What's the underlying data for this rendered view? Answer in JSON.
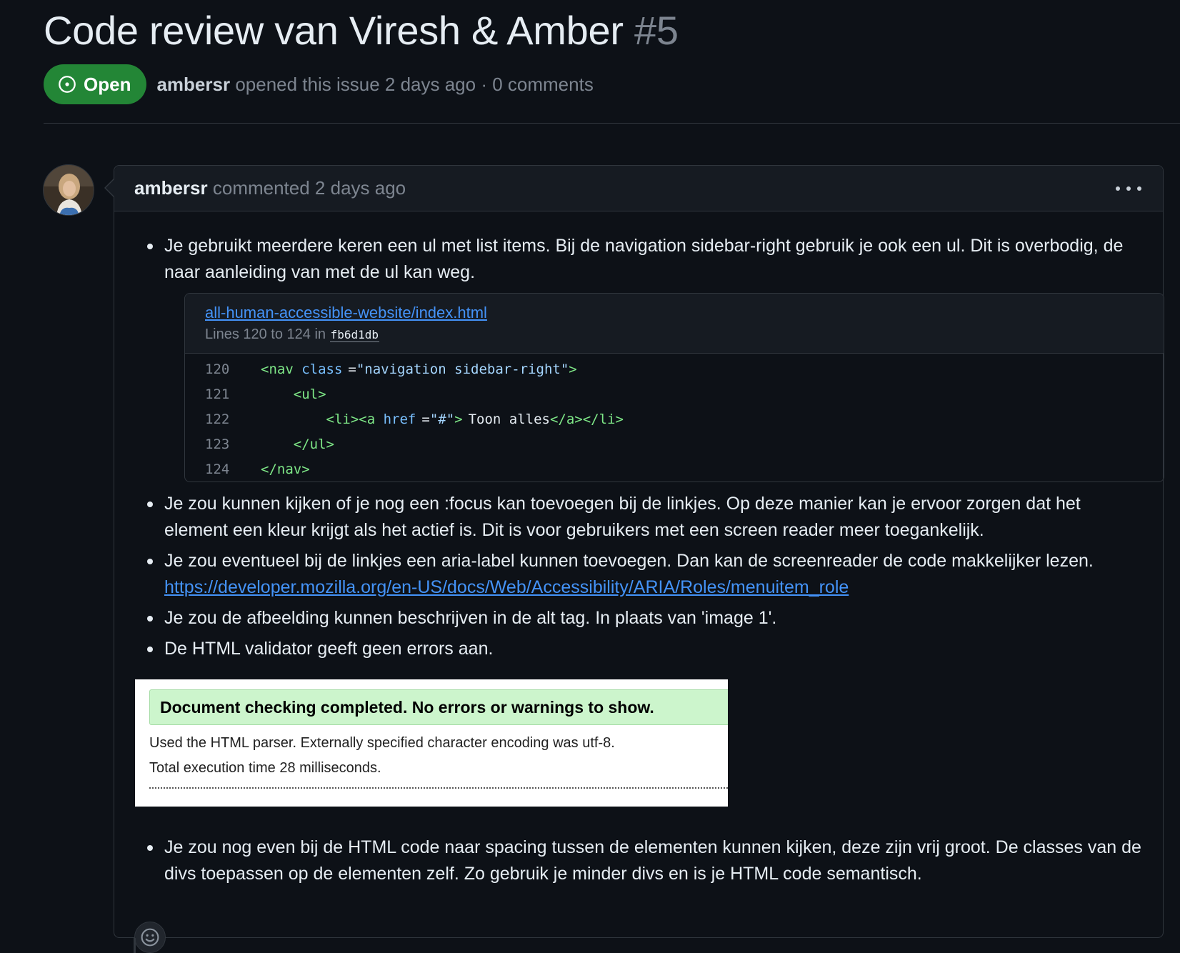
{
  "issue": {
    "title": "Code review van Viresh & Amber",
    "number": "#5",
    "state": "Open",
    "author": "ambersr",
    "meta": "opened this issue 2 days ago · 0 comments"
  },
  "comment": {
    "author": "ambersr",
    "meta": "commented 2 days ago",
    "bullets": [
      "Je gebruikt meerdere keren een ul met list items. Bij de navigation sidebar-right gebruik je ook een ul. Dit is overbodig, de naar aanleiding van met de ul kan weg.",
      "Je zou kunnen kijken of je nog een :focus kan toevoegen bij de linkjes. Op deze manier kan je ervoor zorgen dat het element een kleur krijgt als het actief is. Dit is voor gebruikers met een screen reader meer toegankelijk.",
      "Je zou eventueel bij de linkjes een aria-label kunnen toevoegen. Dan kan de screenreader de code makkelijker lezen.",
      "Je zou de afbeelding kunnen beschrijven in de alt tag. In plaats van 'image 1'.",
      "De HTML validator geeft geen errors aan.",
      "Je zou nog even bij de HTML code naar spacing tussen de elementen kunnen kijken, deze zijn vrij groot. De classes van de divs toepassen op de elementen zelf. Zo gebruik je minder divs en is je HTML code semantisch."
    ],
    "link": "https://developer.mozilla.org/en-US/docs/Web/Accessibility/ARIA/Roles/menuitem_role",
    "snippet": {
      "path": "all-human-accessible-website/index.html",
      "lines_label": "Lines 120 to 124 in",
      "commit": "fb6d1db",
      "lines": [
        {
          "n": "120",
          "indent": "",
          "parts": [
            [
              "tg",
              "<nav"
            ],
            [
              "at",
              " class"
            ],
            [
              "src",
              "="
            ],
            [
              "st",
              "\"navigation sidebar-right\""
            ],
            [
              "tg",
              ">"
            ]
          ]
        },
        {
          "n": "121",
          "indent": "    ",
          "parts": [
            [
              "tg",
              "<ul>"
            ]
          ]
        },
        {
          "n": "122",
          "indent": "        ",
          "parts": [
            [
              "tg",
              "<li><a"
            ],
            [
              "at",
              " href"
            ],
            [
              "src",
              "="
            ],
            [
              "st",
              "\"#\""
            ],
            [
              "tg",
              ">"
            ],
            [
              "src",
              "Toon alles"
            ],
            [
              "tg",
              "</a></li>"
            ]
          ]
        },
        {
          "n": "123",
          "indent": "    ",
          "parts": [
            [
              "tg",
              "</ul>"
            ]
          ]
        },
        {
          "n": "124",
          "indent": "",
          "parts": [
            [
              "tg",
              "</nav>"
            ]
          ]
        }
      ]
    },
    "validator": {
      "success": "Document checking completed. No errors or warnings to show.",
      "line1": "Used the HTML parser. Externally specified character encoding was utf-8.",
      "line2": "Total execution time 28 milliseconds."
    }
  },
  "colors": {
    "background": "#0d1117",
    "open_badge": "#238636",
    "link": "#4493f8",
    "validator_success": "#ccf5cc"
  },
  "icons": [
    "issue-opened-icon",
    "kebab-menu-icon",
    "smiley-icon"
  ]
}
